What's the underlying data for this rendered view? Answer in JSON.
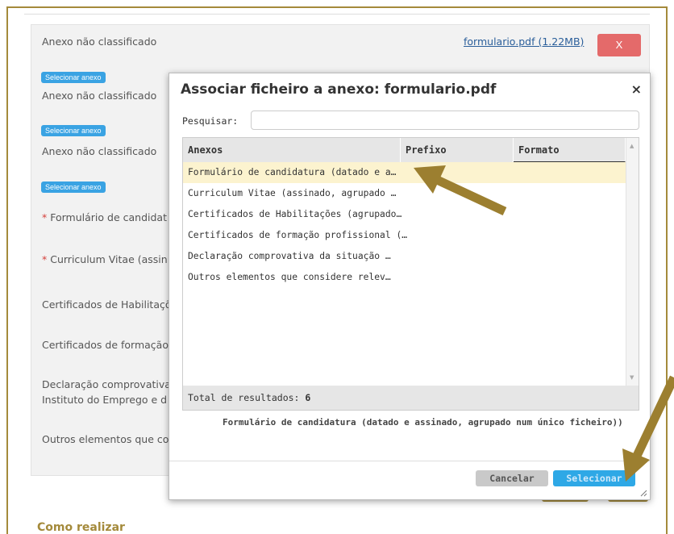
{
  "background": {
    "file_row_label": "Anexo não classificado",
    "file_link": "formulario.pdf (1.22MB)",
    "delete_label": "X",
    "select_badge": "Selecionar anexo",
    "unclassified_label": "Anexo não classificado",
    "required_mark": "*",
    "labels": [
      "Formulário de candidat",
      "Curriculum Vitae (assin",
      "Certificados de Habilitaçõ",
      "Certificados de formação",
      "Declaração comprovativa",
      "Instituto do Emprego e d",
      "Outros elementos que co"
    ],
    "section_title": "Como realizar"
  },
  "dialog": {
    "title": "Associar ficheiro a anexo: formulario.pdf",
    "close_icon": "×",
    "search_label": "Pesquisar:",
    "search_value": "",
    "columns": [
      "Anexos",
      "Prefixo",
      "Formato"
    ],
    "rows": [
      "Formulário de candidatura (datado e a…",
      "Curriculum Vitae (assinado, agrupado …",
      "Certificados de Habilitações (agrupado…",
      "Certificados de formação profissional (…",
      "Declaração comprovativa da situação …",
      "Outros elementos que considere relev…"
    ],
    "selected_row_index": 0,
    "total_label": "Total de resultados:",
    "total_value": "6",
    "selected_full": "Formulário de candidatura (datado e assinado, agrupado num único ficheiro))",
    "cancel_label": "Cancelar",
    "select_label": "Selecionar"
  },
  "colors": {
    "accent_gold": "#a48a3b",
    "select_blue": "#2ea8e6",
    "delete_red": "#e46a6a",
    "highlight_row": "#fcf3cf"
  }
}
